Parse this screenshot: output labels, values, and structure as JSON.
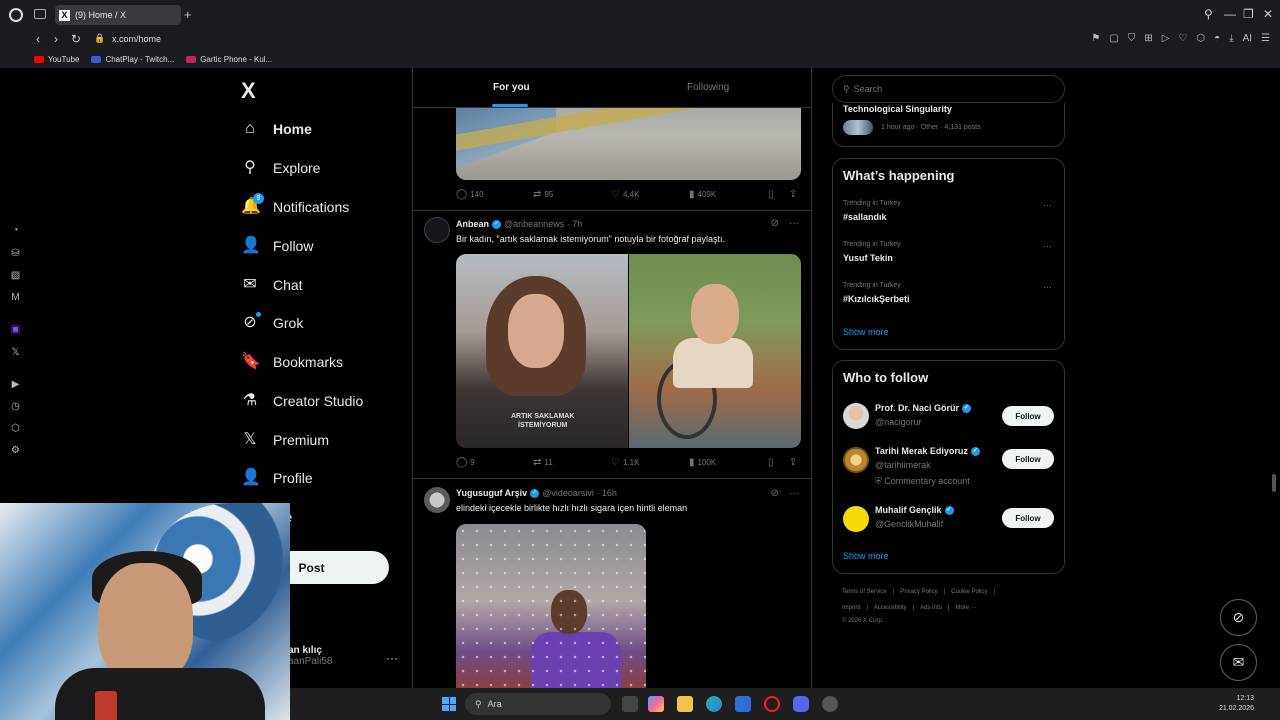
{
  "browser": {
    "tab_title": "(9) Home / X",
    "tab_favicon": "X",
    "url": "x.com/home",
    "bookmarks": [
      {
        "label": "YouTube",
        "color": "#ff0000"
      },
      {
        "label": "ChatPlay - Twitch...",
        "color": "#3b5bdb"
      },
      {
        "label": "Gartic Phone - Kul...",
        "color": "#c2255c"
      }
    ],
    "ext_ai_label": "AI"
  },
  "nav": {
    "logo": "X",
    "items": [
      {
        "label": "Home",
        "icon": "home-icon",
        "glyph": "⌂"
      },
      {
        "label": "Explore",
        "icon": "search-icon",
        "glyph": "⚲"
      },
      {
        "label": "Notifications",
        "icon": "bell-icon",
        "glyph": "🔔",
        "badge": "9"
      },
      {
        "label": "Follow",
        "icon": "add-person-icon",
        "glyph": "👤"
      },
      {
        "label": "Chat",
        "icon": "mail-icon",
        "glyph": "✉"
      },
      {
        "label": "Grok",
        "icon": "grok-icon",
        "glyph": "⊘"
      },
      {
        "label": "Bookmarks",
        "icon": "bookmark-icon",
        "glyph": "🔖"
      },
      {
        "label": "Creator Studio",
        "icon": "flask-icon",
        "glyph": "⚗"
      },
      {
        "label": "Premium",
        "icon": "x-premium-icon",
        "glyph": "𝕏"
      },
      {
        "label": "Profile",
        "icon": "person-icon",
        "glyph": "👤"
      },
      {
        "label": "ore"
      }
    ],
    "post_label": "Post",
    "user_name": "an kılıç",
    "user_handle": "aanPali58"
  },
  "feed": {
    "tabs": [
      "For you",
      "Following"
    ],
    "tweet0_stats": {
      "replies": "140",
      "reposts": "95",
      "likes": "4.4K",
      "views": "409K"
    },
    "tweet1": {
      "name": "Anbean",
      "handle": "@anbeannews · 7h",
      "text": "Bir kadın, \"artık saklamak istemiyorum\" notuyla bir fotoğraf paylaştı.",
      "shirt_text": "ARTIK SAKLAMAK\nİSTEMİYORUM",
      "stats": {
        "replies": "9",
        "reposts": "11",
        "likes": "1.1K",
        "views": "100K"
      }
    },
    "tweet2": {
      "name": "Yugusuguf Arşiv",
      "handle": "@videoarsivi · 16h",
      "text": "elindeki içecekle birlikte hızlı hızlı sigara içen hintli eleman"
    }
  },
  "sidebar": {
    "search_placeholder": "Search",
    "prev_trend": {
      "name": "Technological Singularity",
      "meta": "1 hour ago · Other · 4,131 posts"
    },
    "happening_title": "What’s happening",
    "trends": [
      {
        "meta": "Trending in Turkey",
        "name": "#sallandık"
      },
      {
        "meta": "Trending in Turkey",
        "name": "Yusuf Tekin"
      },
      {
        "meta": "Trending in Turkey",
        "name": "#KızılcıkŞerbeti"
      }
    ],
    "show_more": "Show more",
    "wtf_title": "Who to follow",
    "wtf": [
      {
        "name": "Prof. Dr. Naci Görür",
        "handle": "@nacigorur",
        "note": ""
      },
      {
        "name": "Tarihi Merak Ediyoruz",
        "handle": "@tarihiimerak",
        "note": "Commentary account"
      },
      {
        "name": "Muhalif Gençlik",
        "handle": "@GenclikMuhalif",
        "note": ""
      }
    ],
    "follow_label": "Follow",
    "footer_row1": [
      "Terms of Service",
      "|",
      "Privacy Policy",
      "|",
      "Cookie Policy",
      "|"
    ],
    "footer_row2": [
      "Imprint",
      "|",
      "Accessibility",
      "|",
      "Ads info",
      "|",
      "More ···"
    ],
    "copyright": "© 2026 X Corp."
  },
  "taskbar": {
    "search_placeholder": "Ara",
    "time": "12:13",
    "date": "21.02.2026"
  },
  "colors": {
    "accent": "#1d9bf0",
    "background": "#000000",
    "border": "#2f3336",
    "muted": "#71767b"
  }
}
